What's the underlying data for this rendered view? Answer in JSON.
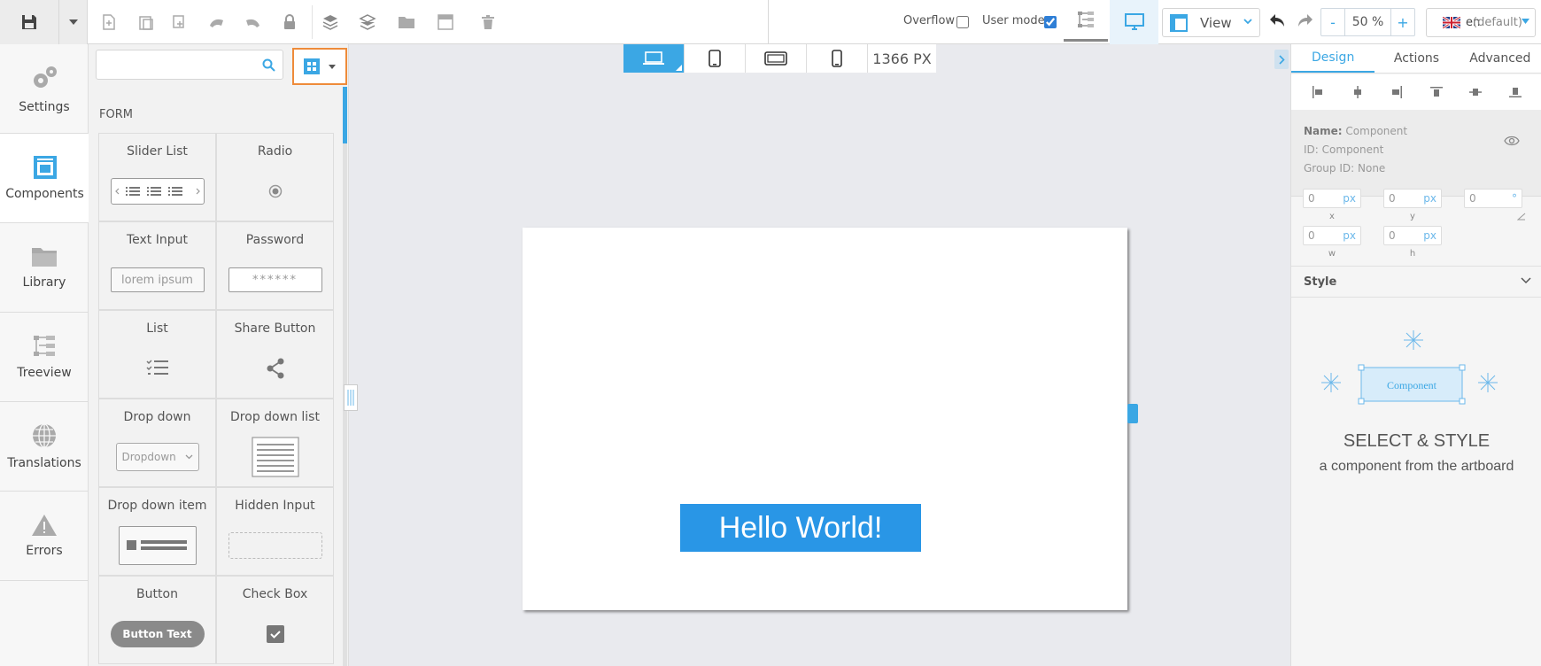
{
  "toolbar": {
    "overflow_label": "Overflow",
    "overflow_checked": false,
    "usermode_label": "User mode",
    "usermode_checked": true,
    "view_label": "View",
    "zoom_minus": "-",
    "zoom_value": "50 %",
    "zoom_plus": "+",
    "lang_code": "en",
    "lang_default": "(default)"
  },
  "nav": {
    "items": [
      {
        "label": "Settings",
        "icon": "gears-icon"
      },
      {
        "label": "Components",
        "icon": "components-icon"
      },
      {
        "label": "Library",
        "icon": "folder-icon"
      },
      {
        "label": "Treeview",
        "icon": "treeview-icon"
      },
      {
        "label": "Translations",
        "icon": "globe-icon"
      },
      {
        "label": "Errors",
        "icon": "warning-icon"
      }
    ],
    "active": "Components"
  },
  "components": {
    "search_placeholder": "",
    "section": "FORM",
    "tiles": [
      {
        "name": "Slider List"
      },
      {
        "name": "Radio"
      },
      {
        "name": "Text Input",
        "preview": "lorem ipsum"
      },
      {
        "name": "Password",
        "preview": "******"
      },
      {
        "name": "List"
      },
      {
        "name": "Share Button"
      },
      {
        "name": "Drop down",
        "preview": "Dropdown"
      },
      {
        "name": "Drop down list"
      },
      {
        "name": "Drop down item"
      },
      {
        "name": "Hidden Input"
      },
      {
        "name": "Button",
        "preview": "Button Text"
      },
      {
        "name": "Check Box"
      }
    ]
  },
  "canvas": {
    "device_width": "1366",
    "device_unit": "PX",
    "hello_text": "Hello World!"
  },
  "right": {
    "tabs": [
      "Design",
      "Actions",
      "Advanced"
    ],
    "active_tab": "Design",
    "name_label": "Name:",
    "name_value": "Component",
    "id_label": "ID:",
    "id_value": "Component",
    "group_label": "Group ID:",
    "group_value": "None",
    "x": "0",
    "y": "0",
    "w": "0",
    "h": "0",
    "rotation": "0",
    "unit": "px",
    "degree": "°",
    "x_label": "x",
    "y_label": "y",
    "w_label": "w",
    "h_label": "h",
    "style_label": "Style",
    "illus_label": "Component",
    "select_title": "SELECT & STYLE",
    "select_sub": "a component from the artboard"
  },
  "colors": {
    "accent": "#3ba7e4",
    "highlight": "#ee8b3a",
    "hello_bg": "#2996e6"
  }
}
